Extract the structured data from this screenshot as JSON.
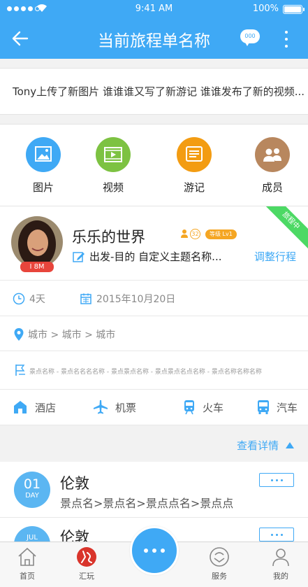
{
  "status_bar": {
    "time": "9:41 AM",
    "battery": "100%"
  },
  "header": {
    "title": "当前旅程单名称",
    "chat_badge": "000"
  },
  "feed": {
    "text": "Tony上传了新图片 谁谁谁又写了新游记 谁谁发布了新的视频..."
  },
  "categories": [
    {
      "label": "图片",
      "icon": "image-icon",
      "color": "#3fa9f5"
    },
    {
      "label": "视频",
      "icon": "video-icon",
      "color": "#7dc242"
    },
    {
      "label": "游记",
      "icon": "notes-icon",
      "color": "#f39c12"
    },
    {
      "label": "成员",
      "icon": "members-icon",
      "color": "#b8875e"
    }
  ],
  "profile": {
    "name": "乐乐的世界",
    "avatar_tag": "I 8M",
    "member_count": "32",
    "level": "等级 Lv1",
    "route": "出发-目的 自定义主题名称...",
    "adjust_label": "调整行程",
    "ribbon": "旅程中"
  },
  "trip": {
    "days": "4天",
    "date": "2015年10月20日",
    "cities": "城市 > 城市 > 城市",
    "spots": "景点名称 - 景点名名名名称 - 景点景点名称 - 景点景点名点名称 - 景点名称名称名称"
  },
  "transport": [
    {
      "label": "酒店",
      "icon": "hotel-icon"
    },
    {
      "label": "机票",
      "icon": "plane-icon"
    },
    {
      "label": "火车",
      "icon": "train-icon"
    },
    {
      "label": "汽车",
      "icon": "bus-icon"
    }
  ],
  "details": {
    "label": "查看详情"
  },
  "itinerary": [
    {
      "day_num": "01",
      "day_label": "DAY",
      "city": "伦敦",
      "spots": "景点名>景点名>景点点名>景点点"
    },
    {
      "day_num": "",
      "day_label": "JUL",
      "city": "伦敦",
      "spots": ""
    }
  ],
  "tabbar": [
    {
      "label": "首页",
      "icon": "home-icon"
    },
    {
      "label": "汇玩",
      "icon": "huiwan-icon"
    },
    {
      "label": "服务",
      "icon": "service-icon"
    },
    {
      "label": "我的",
      "icon": "profile-icon"
    }
  ],
  "colors": {
    "primary": "#3fa9f5",
    "ribbon": "#4cd964",
    "badge": "#f5a623",
    "red": "#e8453c"
  }
}
